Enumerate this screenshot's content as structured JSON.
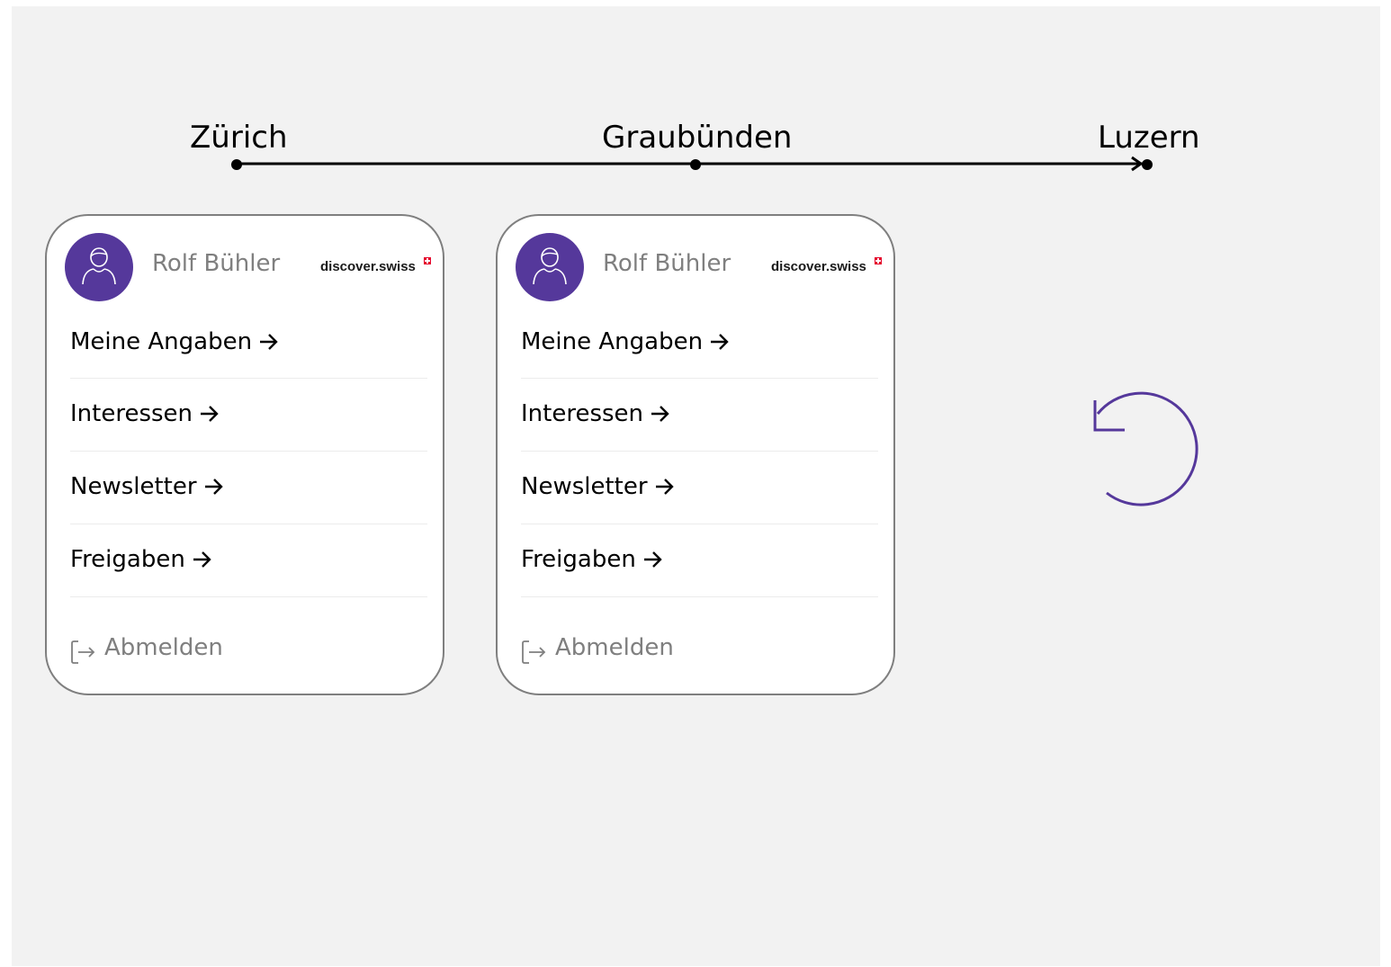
{
  "timeline": {
    "stops": [
      "Zürich",
      "Graubünden",
      "Luzern"
    ]
  },
  "cards": [
    {
      "user_name": "Rolf Bühler",
      "brand": "discover.swiss",
      "menu": [
        "Meine Angaben",
        "Interessen",
        "Newsletter",
        "Freigaben"
      ],
      "logout_label": "Abmelden"
    },
    {
      "user_name": "Rolf Bühler",
      "brand": "discover.swiss",
      "menu": [
        "Meine Angaben",
        "Interessen",
        "Newsletter",
        "Freigaben"
      ],
      "logout_label": "Abmelden"
    }
  ],
  "icons": {
    "avatar": "person-icon",
    "menu_arrow": "arrow-right-icon",
    "logout": "logout-icon",
    "reload": "reload-icon"
  },
  "colors": {
    "accent": "#55389b",
    "background": "#f2f2f2",
    "card_border": "#7f7f7f",
    "muted_text": "#7f7f7f",
    "brand_flag": "#e4002b"
  }
}
